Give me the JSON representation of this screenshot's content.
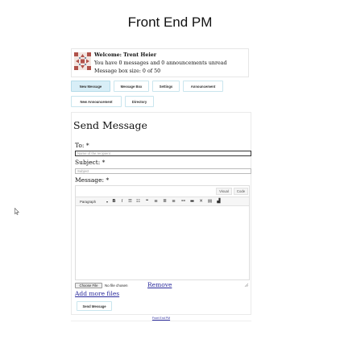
{
  "page": {
    "title": "Front End PM"
  },
  "welcome": {
    "greeting": "Welcome: Trent Heier",
    "messages_line": "You have 0 messages and 0 announcements unread",
    "box_size_line": "Message box size: 0 of 50"
  },
  "nav": {
    "buttons": [
      {
        "label": "New Message",
        "active": true
      },
      {
        "label": "Message Box",
        "active": false
      },
      {
        "label": "Settings",
        "active": false
      },
      {
        "label": "Announcement",
        "active": false
      },
      {
        "label": "New Announcement",
        "active": false
      },
      {
        "label": "Directory",
        "active": false
      }
    ]
  },
  "form": {
    "title": "Send Message",
    "to_label": "To: *",
    "to_placeholder": "Name of the recipient",
    "subject_label": "Subject: *",
    "subject_placeholder": "Subject",
    "message_label": "Message: *",
    "editor_tabs": {
      "visual": "Visual",
      "code": "Code"
    },
    "format_select": "Paragraph",
    "toolbar_icons": [
      "bold-icon",
      "italic-icon",
      "bullet-list-icon",
      "numbered-list-icon",
      "blockquote-icon",
      "align-left-icon",
      "align-center-icon",
      "align-right-icon",
      "link-icon",
      "read-more-icon",
      "fullscreen-icon",
      "toolbar-toggle-icon",
      "chart-icon"
    ],
    "choose_file": "Choose File",
    "no_file": "No file chosen",
    "remove": "Remove",
    "add_more": "Add more files",
    "send": "Send Message"
  },
  "footer": {
    "link": "Front End PM"
  },
  "colors": {
    "accent_border": "#c9e5ee",
    "active_bg": "#d8eef7",
    "link": "#2a2a9c"
  }
}
